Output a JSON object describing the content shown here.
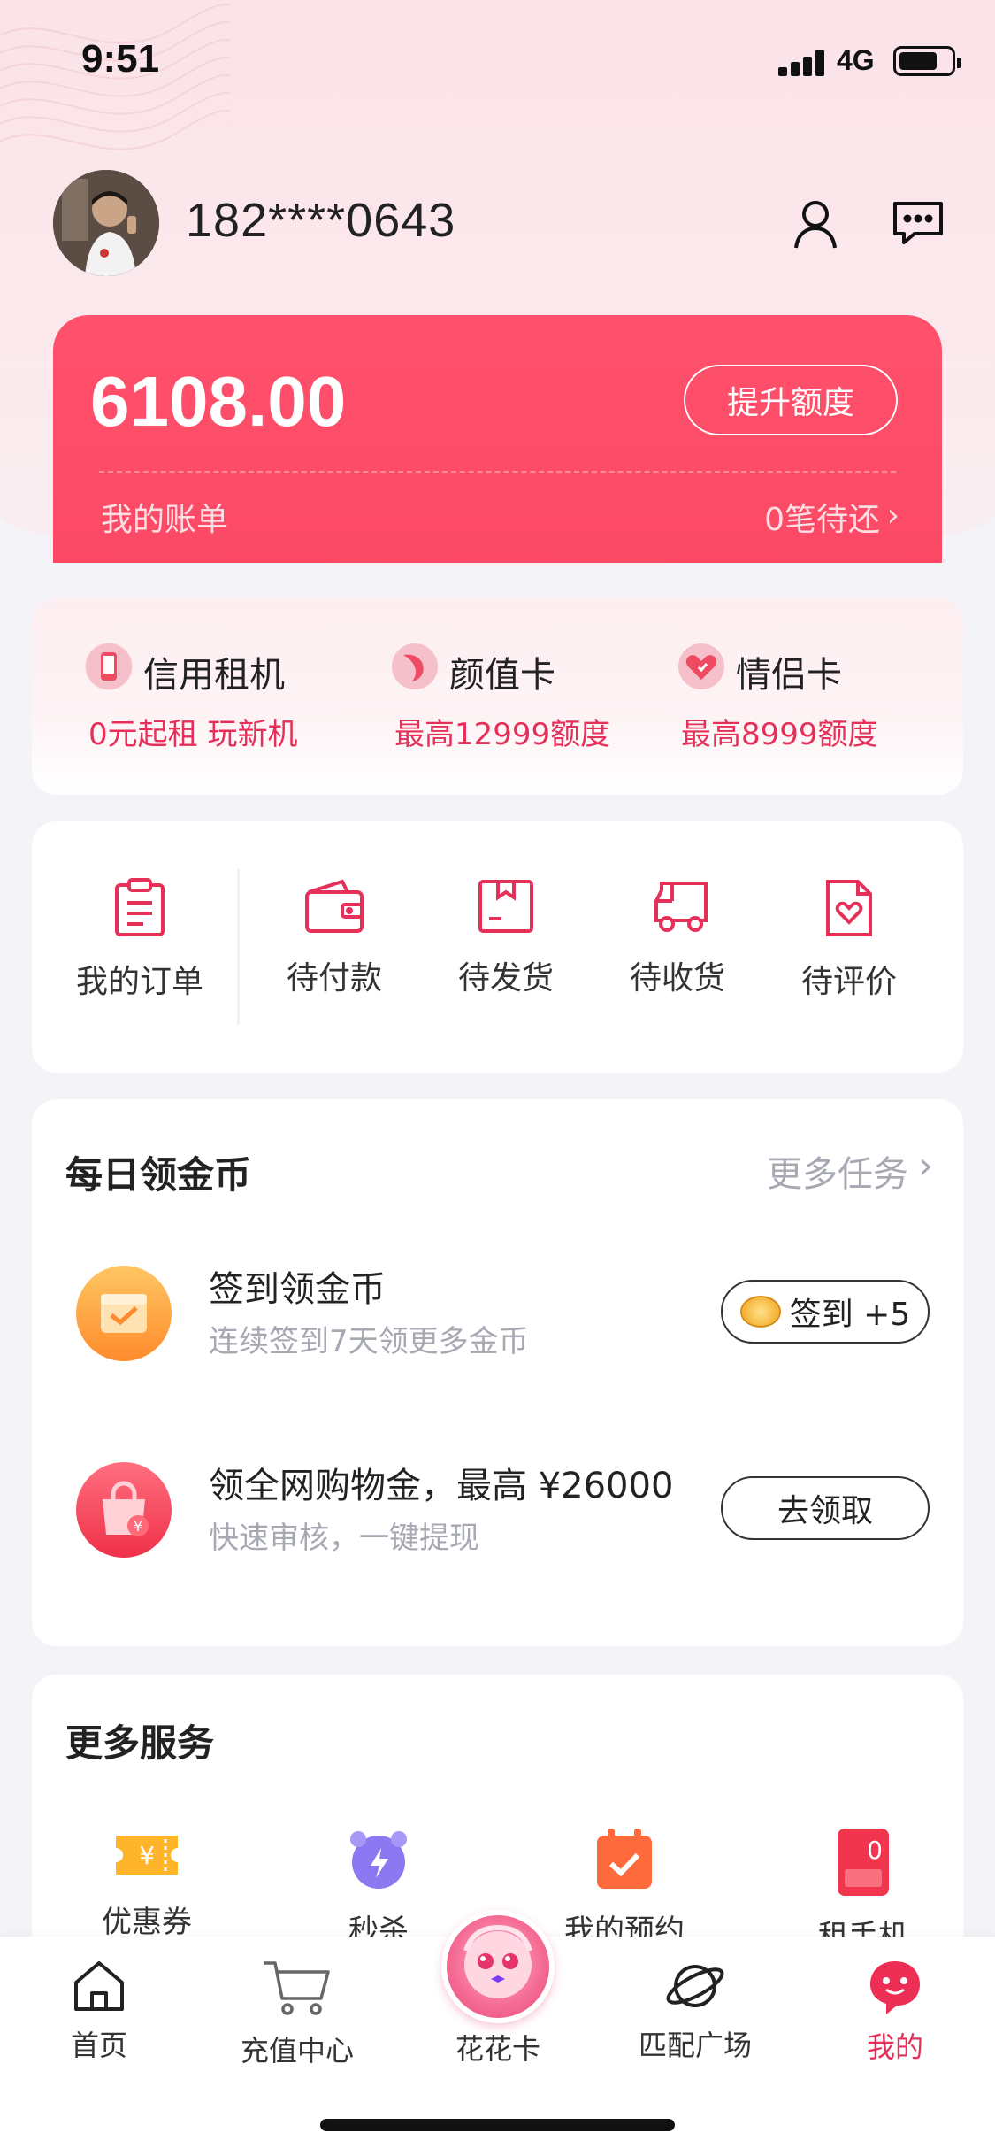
{
  "status_bar": {
    "time": "9:51",
    "network": "4G",
    "battery_level": 0.75
  },
  "profile": {
    "phone": "182****0643",
    "avatar": "avatar-photo"
  },
  "header_icons": [
    "user-icon",
    "message-icon"
  ],
  "credit": {
    "amount": "6108.00",
    "raise_label": "提升额度",
    "bill_label": "我的账单",
    "bill_status": "0笔待还"
  },
  "features": [
    {
      "title": "信用租机",
      "subtitle": "0元起租 玩新机",
      "icon": "phone-rent-icon"
    },
    {
      "title": "颜值卡",
      "subtitle": "最高12999额度",
      "icon": "beauty-card-icon"
    },
    {
      "title": "情侣卡",
      "subtitle": "最高8999额度",
      "icon": "couple-card-icon"
    }
  ],
  "orders": [
    {
      "label": "我的订单",
      "icon": "order-list-icon"
    },
    {
      "label": "待付款",
      "icon": "wallet-icon"
    },
    {
      "label": "待发货",
      "icon": "box-icon"
    },
    {
      "label": "待收货",
      "icon": "truck-icon"
    },
    {
      "label": "待评价",
      "icon": "review-icon"
    }
  ],
  "daily_coins": {
    "title": "每日领金币",
    "more": "更多任务",
    "tasks": [
      {
        "title": "签到领金币",
        "subtitle": "连续签到7天领更多金币",
        "button": "签到 +5",
        "icon": "checkin-calendar-icon"
      },
      {
        "title": "领全网购物金，最高 ¥26000",
        "subtitle": "快速审核，一键提现",
        "button": "去领取",
        "icon": "shopping-bag-icon"
      }
    ]
  },
  "services": {
    "title": "更多服务",
    "items": [
      {
        "label": "优惠券",
        "icon": "coupon-icon"
      },
      {
        "label": "秒杀",
        "icon": "alarm-clock-icon"
      },
      {
        "label": "我的预约",
        "icon": "appointment-icon"
      },
      {
        "label": "租手机",
        "icon": "rent-phone-icon"
      }
    ]
  },
  "tabs": [
    {
      "label": "首页",
      "icon": "home-icon"
    },
    {
      "label": "充值中心",
      "icon": "cart-icon"
    },
    {
      "label": "花花卡",
      "icon": "mascot-icon"
    },
    {
      "label": "匹配广场",
      "icon": "planet-icon"
    },
    {
      "label": "我的",
      "icon": "profile-face-icon",
      "active": true
    }
  ],
  "colors": {
    "accent": "#e5305a",
    "card_red": "#fb4966",
    "muted": "#a6a9b2"
  }
}
